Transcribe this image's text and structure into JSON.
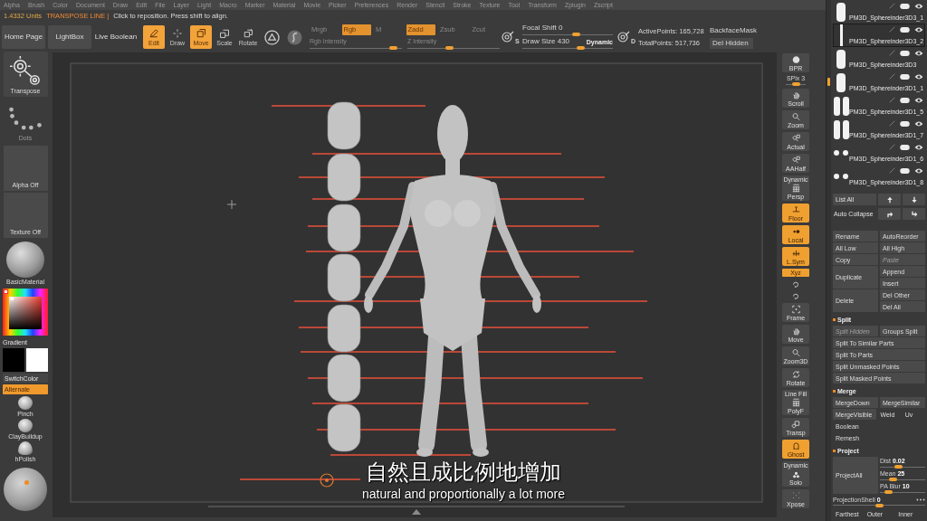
{
  "menu_bar": [
    "Alpha",
    "Brush",
    "Color",
    "Document",
    "Draw",
    "Edit",
    "File",
    "Layer",
    "Light",
    "Macro",
    "Marker",
    "Material",
    "Movie",
    "Picker",
    "Preferences",
    "Render",
    "Stencil",
    "Stroke",
    "Texture",
    "Tool",
    "Transform",
    "Zplugin",
    "Zscript"
  ],
  "status": {
    "units": "1.4332 Units",
    "mode": "TRANSPOSE LINE |",
    "hint": "Click to reposition. Press shift to align."
  },
  "toolbar": {
    "nav": [
      "Home Page",
      "LightBox"
    ],
    "live_boolean": "Live Boolean",
    "modes": [
      {
        "label": "Edit",
        "on": true
      },
      {
        "label": "Draw",
        "on": false
      },
      {
        "label": "Move",
        "on": true
      },
      {
        "label": "Scale",
        "on": false
      },
      {
        "label": "Rotate",
        "on": false
      }
    ],
    "switches": [
      {
        "label": "Mrgb",
        "on": false
      },
      {
        "label": "Rgb",
        "on": true
      },
      {
        "label": "M",
        "on": false
      },
      {
        "label": "Zadd",
        "on": true
      },
      {
        "label": "Zsub",
        "on": false
      },
      {
        "label": "Zcut",
        "on": false
      }
    ],
    "intensity": [
      {
        "label": "Rgb Intensity",
        "level": 0.95
      },
      {
        "label": "Z Intensity",
        "level": 0.45
      }
    ],
    "icon_letters": [
      "S",
      "D"
    ],
    "brush_sliders": [
      {
        "label": "Focal Shift",
        "value": "0",
        "level": 0.6
      },
      {
        "label": "Draw Size",
        "value": "430",
        "level": 0.66
      }
    ],
    "dynamic": "Dynamic",
    "points": [
      "ActivePoints: 165,728",
      "TotalPoints: 517,736"
    ],
    "backface_mask": "BackfaceMask",
    "del_hidden": "Del Hidden"
  },
  "shelf": {
    "transpose": "Transpose",
    "stroke": "Dots",
    "alpha": "Alpha Off",
    "texture": "Texture Off",
    "material": "BasicMaterial",
    "gradient": "Gradient",
    "switch_color": "SwitchColor",
    "alternate": {
      "label": "Alternate",
      "on": true
    },
    "brushes": [
      "Pinch",
      "ClayBuildup",
      "hPolish"
    ]
  },
  "canvas": {
    "subtitle_zh": "自然且成比例地增加",
    "subtitle_en": "natural and proportionally a lot more"
  },
  "view_buttons": [
    {
      "kind": "tile",
      "label": "BPR",
      "on": false
    },
    {
      "kind": "slider",
      "label": "SPix",
      "value": "3",
      "level": 0.5
    },
    {
      "kind": "tile",
      "label": "Scroll",
      "on": false
    },
    {
      "kind": "tile",
      "label": "Zoom",
      "on": false
    },
    {
      "kind": "tile",
      "label": "Actual",
      "on": false
    },
    {
      "kind": "tile",
      "label": "AAHalf",
      "on": false
    },
    {
      "kind": "tile",
      "caption": "Dynamic",
      "label": "Persp",
      "on": false
    },
    {
      "kind": "tile",
      "label": "Floor",
      "on": true
    },
    {
      "kind": "tile",
      "label": "Local",
      "on": true
    },
    {
      "kind": "tile",
      "label": "L.Sym",
      "on": true
    },
    {
      "kind": "chip",
      "label": "Xyz",
      "on": true
    },
    {
      "kind": "mini"
    },
    {
      "kind": "mini"
    },
    {
      "kind": "tile",
      "label": "Frame",
      "on": false
    },
    {
      "kind": "tile",
      "label": "Move",
      "on": false
    },
    {
      "kind": "tile",
      "label": "Zoom3D",
      "on": false
    },
    {
      "kind": "tile",
      "label": "Rotate",
      "on": false
    },
    {
      "kind": "tile",
      "caption": "Line Fill",
      "label": "PolyF",
      "on": false
    },
    {
      "kind": "tile",
      "label": "Transp",
      "on": false
    },
    {
      "kind": "tile",
      "label": "Ghost",
      "on": true
    },
    {
      "kind": "tile",
      "caption": "Dynamic",
      "label": "Solo",
      "on": false
    },
    {
      "kind": "tile",
      "label": "Xpose",
      "on": false
    }
  ],
  "subtools": [
    {
      "name": "PM3D_Sphereinder3D3_1",
      "selected": false,
      "kind": "capsule"
    },
    {
      "name": "PM3D_Sphereinder3D3_2",
      "selected": true,
      "kind": "line"
    },
    {
      "name": "PM3D_Sphereinder3D3",
      "selected": false,
      "kind": "capsule"
    },
    {
      "name": "PM3D_Sphereinder3D1_1",
      "selected": false,
      "kind": "capsule"
    },
    {
      "name": "PM3D_Sphereinder3D1_5",
      "selected": false,
      "kind": "capsule-pair"
    },
    {
      "name": "PM3D_Sphereinder3D1_7",
      "selected": false,
      "kind": "capsule-pair"
    },
    {
      "name": "PM3D_Sphereinder3D1_6",
      "selected": false,
      "kind": "dot-pair"
    },
    {
      "name": "PM3D_Sphereinder3D1_8",
      "selected": false,
      "kind": "dot-pair"
    }
  ],
  "list_controls": {
    "list_all": "List All",
    "auto_collapse": "Auto Collapse"
  },
  "subtool_actions": [
    {
      "kind": "row",
      "items": [
        {
          "label": "Rename",
          "kind": "button",
          "disabled": false
        },
        {
          "label": "AutoReorder",
          "kind": "button",
          "disabled": false
        }
      ]
    },
    {
      "kind": "row",
      "items": [
        {
          "label": "All Low",
          "kind": "button",
          "disabled": false
        },
        {
          "label": "All High",
          "kind": "button",
          "disabled": false
        }
      ]
    },
    {
      "kind": "row",
      "items": [
        {
          "label": "Copy",
          "kind": "button",
          "disabled": false
        },
        {
          "label": "Paste",
          "kind": "button",
          "disabled": true
        }
      ]
    },
    {
      "kind": "stack",
      "label": "Duplicate",
      "items": [
        {
          "label": "Append",
          "disabled": false
        },
        {
          "label": "Insert",
          "disabled": false
        }
      ]
    },
    {
      "kind": "stack",
      "label": "Delete",
      "items": [
        {
          "label": "Del Other",
          "disabled": false
        },
        {
          "label": "Del All",
          "disabled": false
        }
      ]
    }
  ],
  "sections": [
    {
      "title": "Split",
      "rows": [
        {
          "kind": "row",
          "items": [
            {
              "label": "Split Hidden",
              "kind": "button",
              "disabled": true
            },
            {
              "label": "Groups Split",
              "kind": "button",
              "disabled": false
            }
          ]
        },
        {
          "kind": "row",
          "items": [
            {
              "label": "Split To Similar Parts",
              "kind": "button",
              "disabled": false
            }
          ]
        },
        {
          "kind": "row",
          "items": [
            {
              "label": "Split To Parts",
              "kind": "button",
              "disabled": false
            }
          ]
        },
        {
          "kind": "row",
          "items": [
            {
              "label": "Split Unmasked Points",
              "kind": "button",
              "disabled": false
            }
          ]
        },
        {
          "kind": "row",
          "items": [
            {
              "label": "Split Masked Points",
              "kind": "button",
              "disabled": false
            }
          ]
        }
      ]
    },
    {
      "title": "Merge",
      "rows": [
        {
          "kind": "row",
          "items": [
            {
              "label": "MergeDown",
              "kind": "button",
              "disabled": false
            },
            {
              "label": "MergeSimilar",
              "kind": "button",
              "disabled": false
            }
          ]
        },
        {
          "kind": "row",
          "items": [
            {
              "label": "MergeVisible",
              "kind": "button",
              "disabled": false
            },
            {
              "label": "Weld",
              "kind": "flat",
              "disabled": false
            },
            {
              "label": "Uv",
              "kind": "flat",
              "disabled": false
            }
          ]
        },
        {
          "kind": "row",
          "items": [
            {
              "label": "Boolean",
              "kind": "flat",
              "disabled": false
            }
          ]
        },
        {
          "kind": "row",
          "items": [
            {
              "label": "Remesh",
              "kind": "flat",
              "disabled": false
            }
          ]
        }
      ]
    },
    {
      "title": "Project",
      "rows": [
        {
          "kind": "project",
          "label": "ProjectAll",
          "sliders": [
            {
              "label": "Dist",
              "value": "0.02",
              "level": 0.38
            },
            {
              "label": "Mean",
              "value": "25",
              "level": 0.25
            },
            {
              "label": "PA Blur",
              "value": "10",
              "level": 0.12
            }
          ]
        },
        {
          "kind": "slider",
          "label": "ProjectionShell",
          "value": "0",
          "level": 0.5
        },
        {
          "kind": "row",
          "items": [
            {
              "label": "Farthest",
              "kind": "flat",
              "disabled": false
            },
            {
              "label": "Outer",
              "kind": "flat",
              "disabled": false
            },
            {
              "label": "Inner",
              "kind": "flat",
              "disabled": false
            }
          ]
        }
      ]
    }
  ]
}
